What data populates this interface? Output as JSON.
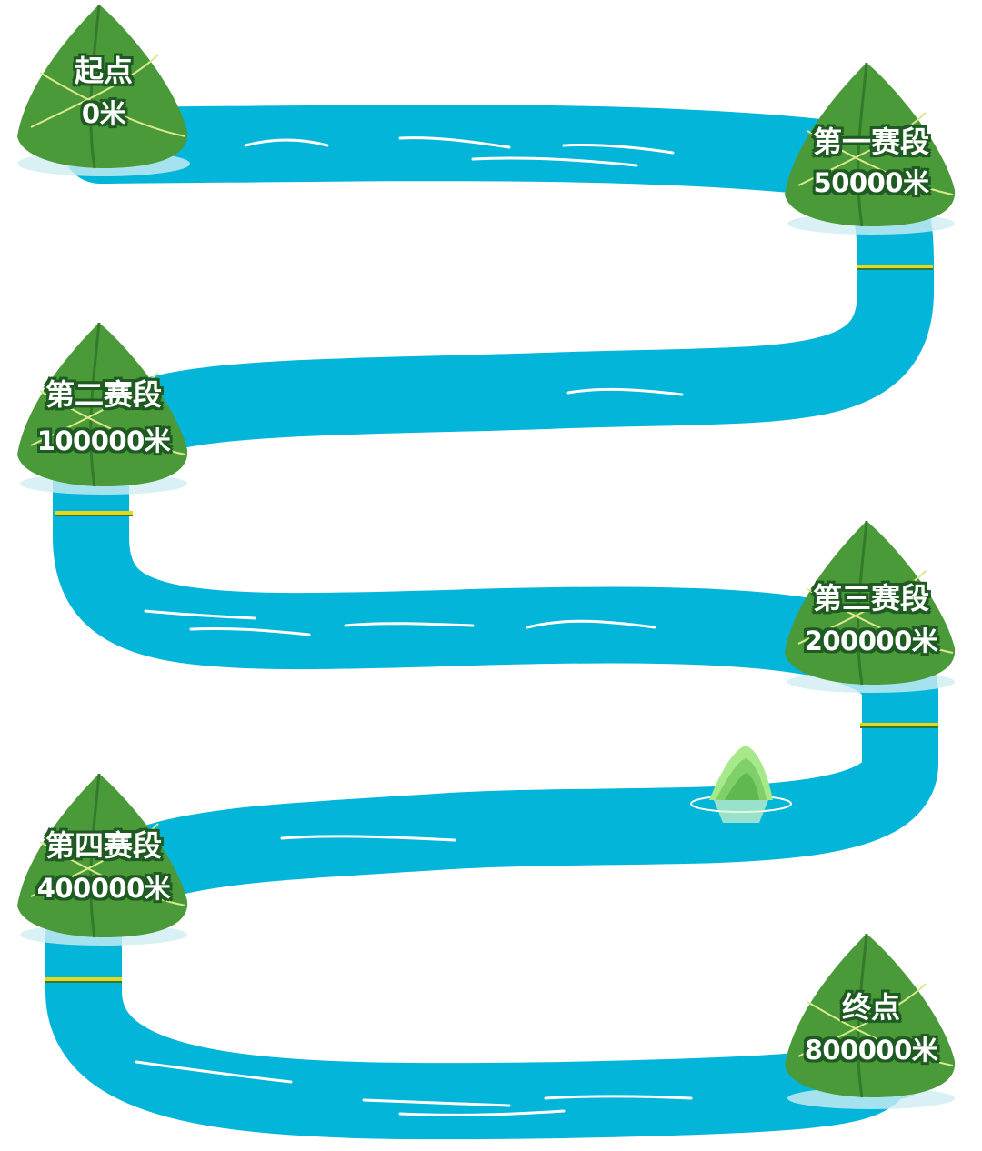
{
  "colors": {
    "river": "#02b5d9",
    "river_light": "#7fdcf0",
    "ripple": "#ffffff",
    "zongzi_leaf": "#4a9a3a",
    "zongzi_dark": "#357a2a",
    "zongzi_line": "#d9e88a",
    "marker_yellow": "#e8d61a",
    "marker_green": "#2b7a3c",
    "text_fill": "#ffffff",
    "text_outline": "#1f5a22",
    "mountain": "#8fdc6a"
  },
  "checkpoints": [
    {
      "title": "起点",
      "distance": "0米"
    },
    {
      "title": "第一赛段",
      "distance": "50000米"
    },
    {
      "title": "第二赛段",
      "distance": "100000米"
    },
    {
      "title": "第三赛段",
      "distance": "200000米"
    },
    {
      "title": "第四赛段",
      "distance": "400000米"
    },
    {
      "title": "终点",
      "distance": "800000米"
    }
  ]
}
